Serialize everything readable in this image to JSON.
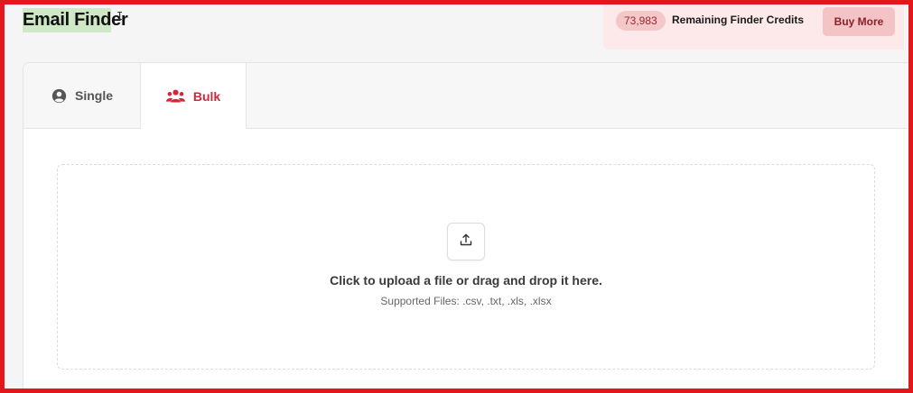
{
  "header": {
    "title_highlighted": "Email Find",
    "title_rest": "er"
  },
  "credits": {
    "count": "73,983",
    "label": "Remaining Finder Credits",
    "buy_label": "Buy More"
  },
  "tabs": [
    {
      "label": "Single",
      "icon": "user-circle-icon",
      "active": false
    },
    {
      "label": "Bulk",
      "icon": "users-group-icon",
      "active": true
    }
  ],
  "upload": {
    "icon": "upload-icon",
    "instruction": "Click to upload a file or drag and drop it here.",
    "supported": "Supported Files: .csv, .txt, .xls, .xlsx"
  },
  "colors": {
    "accent": "#d1273a",
    "frame_border": "#e3161b",
    "title_highlight": "#cfe8c5",
    "credits_bg": "#fde9ea"
  }
}
